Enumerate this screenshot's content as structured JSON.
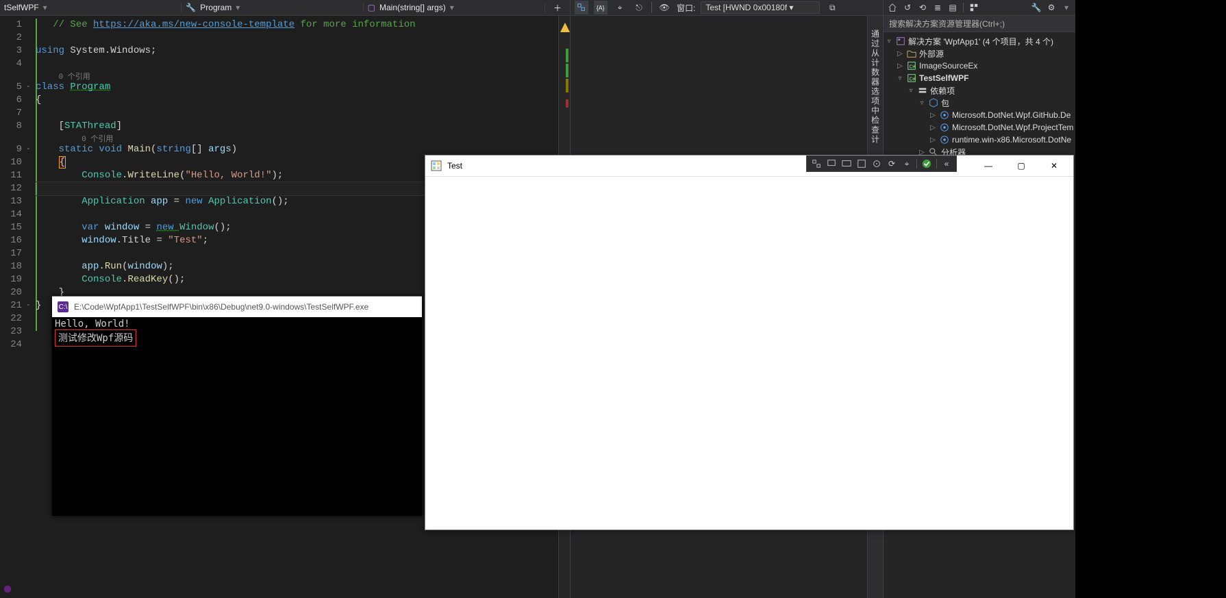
{
  "breadcrumb": {
    "file": "tSelfWPF",
    "class_icon": "🔑",
    "class_label": "Program",
    "method_icon": "🔒",
    "method_label": "Main(string[] args)",
    "plus": "＋"
  },
  "code": {
    "refcount": "0 个引用",
    "lines": [
      {
        "n": "1",
        "tokens": [
          {
            "t": "   ",
            "c": ""
          },
          {
            "t": "// See ",
            "c": "comment"
          },
          {
            "t": "https://aka.ms/new-console-template",
            "c": "link"
          },
          {
            "t": " for more information",
            "c": "comment"
          }
        ]
      },
      {
        "n": "2",
        "tokens": []
      },
      {
        "n": "3",
        "tokens": [
          {
            "t": "using ",
            "c": "keyword"
          },
          {
            "t": "System.Windows",
            "c": "plain"
          },
          {
            "t": ";",
            "c": "plain"
          }
        ]
      },
      {
        "n": "4",
        "tokens": []
      },
      {
        "n": "4r",
        "refline": true
      },
      {
        "n": "5",
        "fold": "-",
        "tokens": [
          {
            "t": "class ",
            "c": "keyword"
          },
          {
            "t": "Program",
            "c": "type wavy"
          }
        ]
      },
      {
        "n": "6",
        "tokens": [
          {
            "t": "{",
            "c": "plain"
          }
        ]
      },
      {
        "n": "7",
        "tokens": []
      },
      {
        "n": "8",
        "tokens": [
          {
            "t": "    ",
            "c": "ws"
          },
          {
            "t": "[",
            "c": "plain"
          },
          {
            "t": "STAThread",
            "c": "type"
          },
          {
            "t": "]",
            "c": "plain"
          }
        ]
      },
      {
        "n": "8r",
        "refline": true,
        "indent": "        "
      },
      {
        "n": "9",
        "fold": "-",
        "tokens": [
          {
            "t": "    ",
            "c": "ws"
          },
          {
            "t": "static ",
            "c": "keyword"
          },
          {
            "t": "void ",
            "c": "keyword"
          },
          {
            "t": "Main",
            "c": "method"
          },
          {
            "t": "(",
            "c": "plain"
          },
          {
            "t": "string",
            "c": "keyword"
          },
          {
            "t": "[] ",
            "c": "plain"
          },
          {
            "t": "args",
            "c": "param"
          },
          {
            "t": ")",
            "c": "plain"
          }
        ]
      },
      {
        "n": "10",
        "tokens": [
          {
            "t": "    ",
            "c": "ws"
          },
          {
            "t": "{",
            "c": "plain redboxchar"
          }
        ]
      },
      {
        "n": "11",
        "tokens": [
          {
            "t": "        ",
            "c": "ws"
          },
          {
            "t": "Console",
            "c": "type"
          },
          {
            "t": ".",
            "c": "plain"
          },
          {
            "t": "WriteLine",
            "c": "method"
          },
          {
            "t": "(",
            "c": "plain"
          },
          {
            "t": "\"Hello, World!\"",
            "c": "string"
          },
          {
            "t": ");",
            "c": "plain"
          }
        ]
      },
      {
        "n": "12",
        "hl": true,
        "tokens": []
      },
      {
        "n": "13",
        "tokens": [
          {
            "t": "        ",
            "c": "ws"
          },
          {
            "t": "Application",
            "c": "type"
          },
          {
            "t": " app ",
            "c": "param"
          },
          {
            "t": "= ",
            "c": "plain"
          },
          {
            "t": "new ",
            "c": "keyword"
          },
          {
            "t": "Application",
            "c": "type"
          },
          {
            "t": "();",
            "c": "plain"
          }
        ]
      },
      {
        "n": "14",
        "tokens": []
      },
      {
        "n": "15",
        "tokens": [
          {
            "t": "        ",
            "c": "ws"
          },
          {
            "t": "var ",
            "c": "keyword"
          },
          {
            "t": "window ",
            "c": "param"
          },
          {
            "t": "= ",
            "c": "plain"
          },
          {
            "t": "new ",
            "c": "keyword wavy"
          },
          {
            "t": "Window",
            "c": "type"
          },
          {
            "t": "();",
            "c": "plain"
          }
        ]
      },
      {
        "n": "16",
        "tokens": [
          {
            "t": "        ",
            "c": "ws"
          },
          {
            "t": "window",
            "c": "param"
          },
          {
            "t": ".",
            "c": "plain"
          },
          {
            "t": "Title ",
            "c": "plain"
          },
          {
            "t": "= ",
            "c": "plain"
          },
          {
            "t": "\"Test\"",
            "c": "string"
          },
          {
            "t": ";",
            "c": "plain"
          }
        ]
      },
      {
        "n": "17",
        "tokens": []
      },
      {
        "n": "18",
        "tokens": [
          {
            "t": "        ",
            "c": "ws"
          },
          {
            "t": "app",
            "c": "param"
          },
          {
            "t": ".",
            "c": "plain"
          },
          {
            "t": "Run",
            "c": "method"
          },
          {
            "t": "(",
            "c": "plain"
          },
          {
            "t": "window",
            "c": "param"
          },
          {
            "t": ");",
            "c": "plain"
          }
        ]
      },
      {
        "n": "19",
        "tokens": [
          {
            "t": "        ",
            "c": "ws"
          },
          {
            "t": "Console",
            "c": "type"
          },
          {
            "t": ".",
            "c": "plain"
          },
          {
            "t": "ReadKey",
            "c": "method"
          },
          {
            "t": "();",
            "c": "plain"
          }
        ]
      },
      {
        "n": "20",
        "tokens": [
          {
            "t": "    ",
            "c": "ws"
          },
          {
            "t": "}",
            "c": "plain"
          }
        ]
      },
      {
        "n": "21",
        "fold": "-",
        "tokens": [
          {
            "t": "}",
            "c": "plain"
          }
        ]
      },
      {
        "n": "22",
        "tokens": []
      },
      {
        "n": "23",
        "tokens": []
      },
      {
        "n": "24",
        "tokens": []
      }
    ]
  },
  "console": {
    "title": "E:\\Code\\WpfApp1\\TestSelfWPF\\bin\\x86\\Debug\\net9.0-windows\\TestSelfWPF.exe",
    "line1": "Hello, World!",
    "line2": "测试修改Wpf源码"
  },
  "livetree": {
    "win_label": "窗口:",
    "win_value": "Test [HWND 0x00180f",
    "side_label": "通过从计数器选项中检查计"
  },
  "solution": {
    "search_placeholder": "搜索解决方案资源管理器(Ctrl+;)",
    "root": "解决方案 'WpfApp1' (4 个项目，共 4 个)",
    "items": [
      {
        "lvl": 1,
        "exp": "▷",
        "ico": "folder",
        "label": "外部源"
      },
      {
        "lvl": 1,
        "exp": "▷",
        "ico": "csproj",
        "label": "ImageSourceEx"
      },
      {
        "lvl": 1,
        "exp": "▿",
        "ico": "csproj",
        "label": "TestSelfWPF",
        "bold": true
      },
      {
        "lvl": 2,
        "exp": "▿",
        "ico": "deps",
        "label": "依赖项"
      },
      {
        "lvl": 3,
        "exp": "▿",
        "ico": "pkg",
        "label": "包"
      },
      {
        "lvl": 4,
        "exp": "▷",
        "ico": "nuget",
        "label": "Microsoft.DotNet.Wpf.GitHub.De"
      },
      {
        "lvl": 4,
        "exp": "▷",
        "ico": "nuget",
        "label": "Microsoft.DotNet.Wpf.ProjectTem"
      },
      {
        "lvl": 4,
        "exp": "▷",
        "ico": "nuget",
        "label": "runtime.win-x86.Microsoft.DotNe"
      },
      {
        "lvl": 3,
        "exp": "▷",
        "ico": "analyzer",
        "label": "分析器"
      }
    ]
  },
  "wpf": {
    "title": "Test"
  },
  "debugbar": {
    "check": "✓"
  },
  "toolbar_icons": [
    "home",
    "refresh",
    "sync",
    "collapse",
    "stack",
    "group",
    "props",
    "wrench",
    "gear"
  ]
}
